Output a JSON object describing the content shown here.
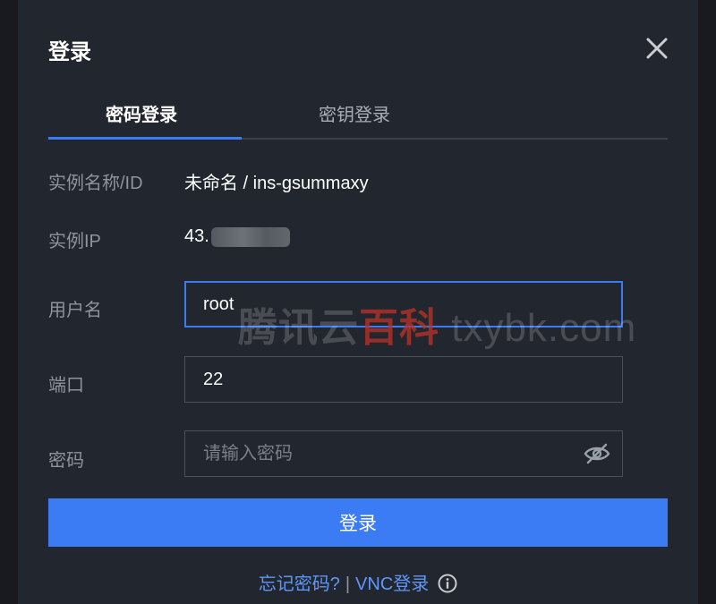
{
  "dialog": {
    "title": "登录",
    "close_icon": "close-icon"
  },
  "tabs": [
    {
      "label": "密码登录",
      "active": true
    },
    {
      "label": "密钥登录",
      "active": false
    }
  ],
  "instance": {
    "name_label": "实例名称/ID",
    "name_value": "未命名 / ins-gsummaxy",
    "ip_label": "实例IP",
    "ip_value_visible": "43."
  },
  "form": {
    "username_label": "用户名",
    "username_value": "root",
    "port_label": "端口",
    "port_value": "22",
    "password_label": "密码",
    "password_placeholder": "请输入密码",
    "password_toggle_icon": "eye-off-icon"
  },
  "submit_label": "登录",
  "footer": {
    "forgot_password": "忘记密码?",
    "separator": "|",
    "vnc_login": "VNC登录",
    "info_icon": "info-icon"
  },
  "watermark": {
    "part1": "腾讯云",
    "part2": "百科",
    "part3": " txybk.com"
  },
  "colors": {
    "background": "#22262e",
    "accent": "#3b7cf5",
    "link": "#5f97f7"
  }
}
